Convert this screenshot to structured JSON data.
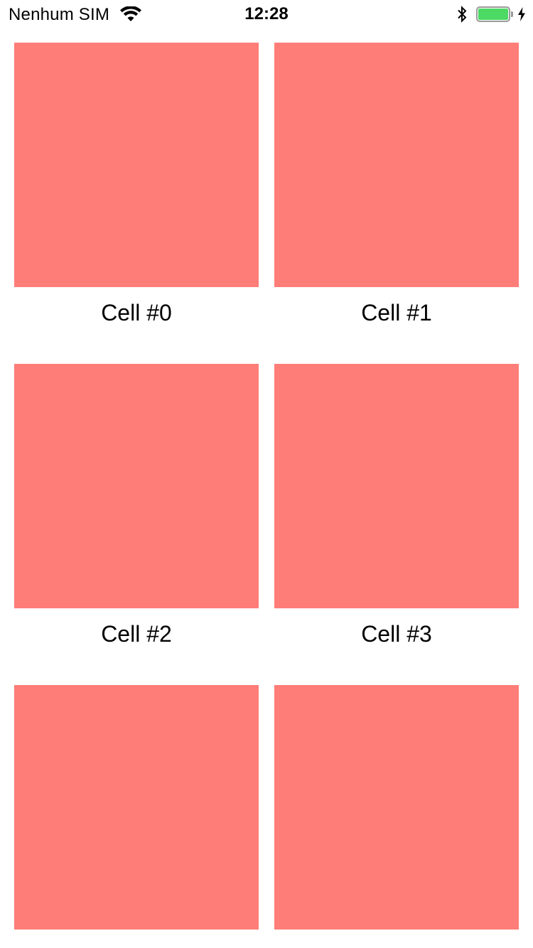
{
  "status_bar": {
    "carrier": "Nenhum SIM",
    "time": "12:28",
    "battery_level": 1.0,
    "charging": true,
    "icons": [
      "wifi-icon",
      "bluetooth-icon",
      "battery-icon",
      "charging-icon"
    ]
  },
  "colors": {
    "cell_fill": "#ff7d78",
    "battery_fill": "#4cd964"
  },
  "cells": [
    {
      "label": "Cell #0"
    },
    {
      "label": "Cell #1"
    },
    {
      "label": "Cell #2"
    },
    {
      "label": "Cell #3"
    },
    {
      "label": ""
    },
    {
      "label": ""
    }
  ]
}
